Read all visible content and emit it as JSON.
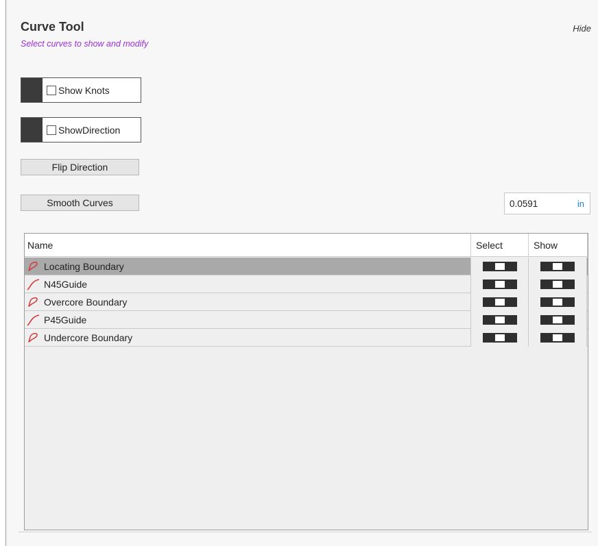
{
  "panel": {
    "title": "Curve Tool",
    "subtitle": "Select curves to show and modify",
    "hide_label": "Hide"
  },
  "controls": {
    "show_knots": {
      "label": "Show Knots",
      "checked": false
    },
    "show_direction": {
      "label": "ShowDirection",
      "checked": false
    },
    "flip_direction_label": "Flip Direction",
    "smooth_curves_label": "Smooth Curves",
    "tolerance": {
      "value": "0.0591",
      "unit": "in"
    }
  },
  "table": {
    "columns": [
      "Name",
      "Select",
      "Show"
    ],
    "rows": [
      {
        "name": "Locating Boundary",
        "icon": "closed-curve-icon",
        "selected": true,
        "select_on": true,
        "show_on": true
      },
      {
        "name": "N45Guide",
        "icon": "open-curve-icon",
        "selected": false,
        "select_on": true,
        "show_on": true
      },
      {
        "name": "Overcore Boundary",
        "icon": "closed-curve-icon",
        "selected": false,
        "select_on": true,
        "show_on": true
      },
      {
        "name": "P45Guide",
        "icon": "open-curve-icon",
        "selected": false,
        "select_on": true,
        "show_on": true
      },
      {
        "name": "Undercore Boundary",
        "icon": "closed-curve-icon",
        "selected": false,
        "select_on": true,
        "show_on": true
      }
    ]
  },
  "colors": {
    "subtitle": "#9b30d9",
    "unit": "#1a7fd0",
    "curve_icon": "#d23a3a",
    "selected_row": "#a9a9a9"
  }
}
